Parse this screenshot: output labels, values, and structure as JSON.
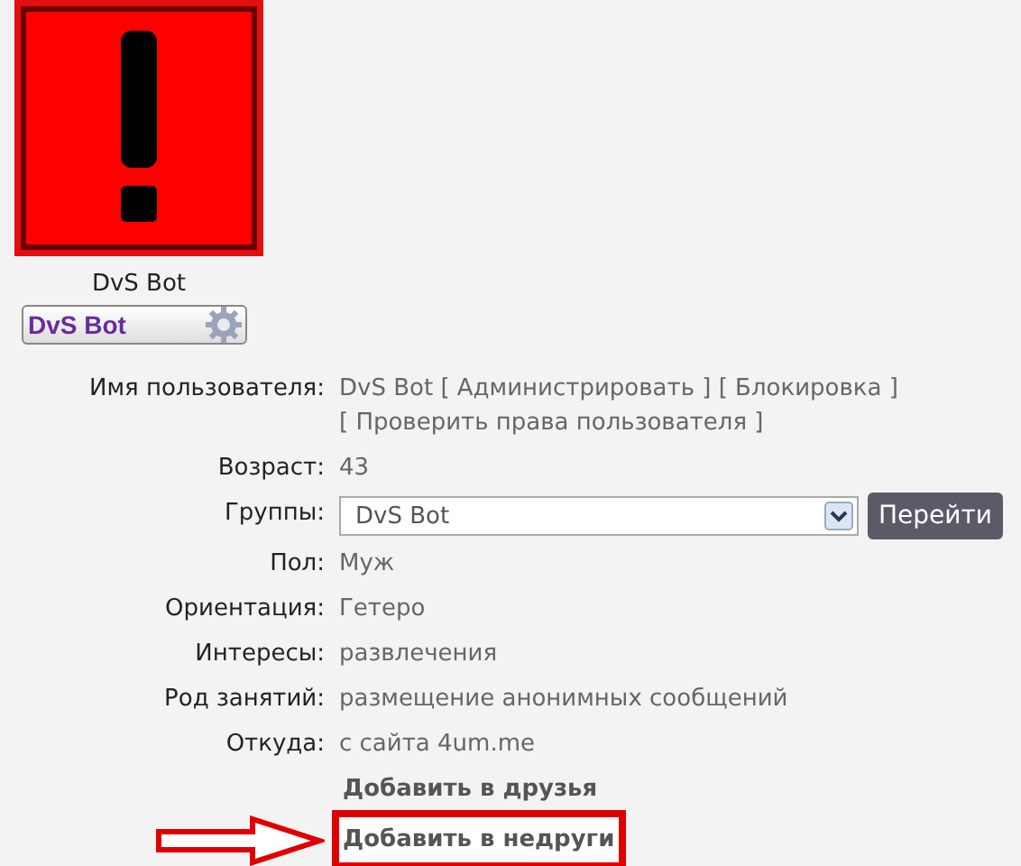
{
  "username": "DvS Bot",
  "rank": {
    "label": "DvS Bot"
  },
  "fields": [
    {
      "kind": "links",
      "label": "Имя пользователя:",
      "value": "DvS Bot",
      "links": [
        "[ Администрировать ]",
        "[ Блокировка ]",
        "[ Проверить права пользователя ]"
      ]
    },
    {
      "kind": "text",
      "label": "Возраст:",
      "value": "43"
    },
    {
      "kind": "select",
      "label": "Группы:",
      "value": "DvS Bot",
      "button": "Перейти"
    },
    {
      "kind": "text",
      "label": "Пол:",
      "value": "Муж"
    },
    {
      "kind": "text",
      "label": "Ориентация:",
      "value": "Гетеро"
    },
    {
      "kind": "text",
      "label": "Интересы:",
      "value": "развлечения"
    },
    {
      "kind": "text",
      "label": "Род занятий:",
      "value": "размещение анонимных сообщений"
    },
    {
      "kind": "text",
      "label": "Откуда:",
      "value": "с сайта 4um.me"
    }
  ],
  "actions": [
    {
      "label": "Добавить в друзья",
      "highlighted": false
    },
    {
      "label": "Добавить в недруги",
      "highlighted": true
    }
  ]
}
